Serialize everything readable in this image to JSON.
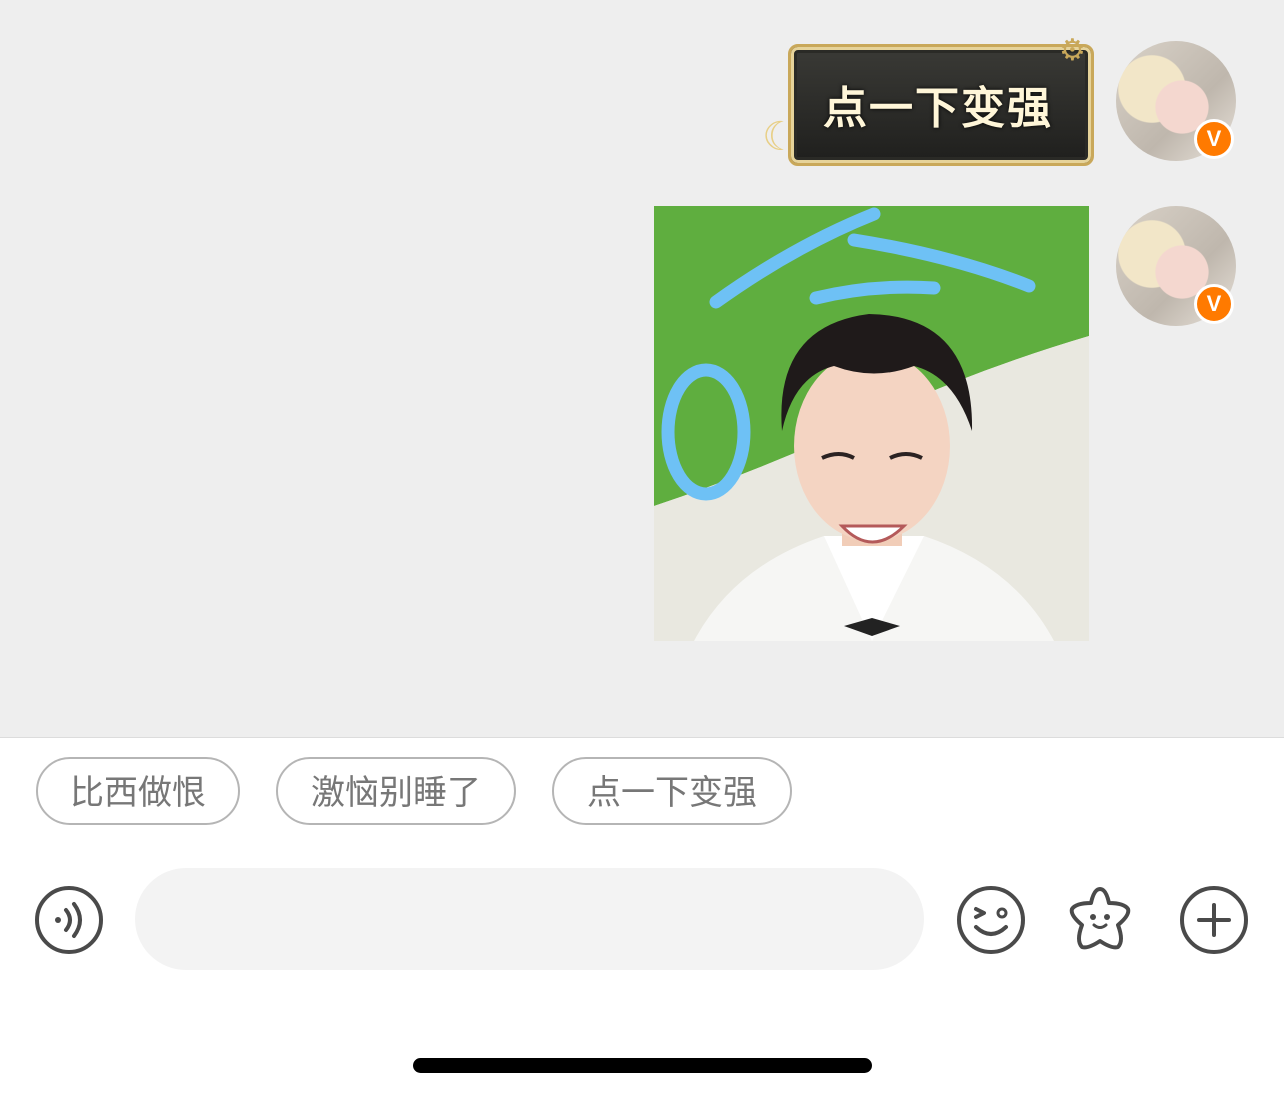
{
  "messages": [
    {
      "type": "sticker",
      "text": "点一下变强",
      "sender_badge": "V"
    },
    {
      "type": "image",
      "sender_badge": "V"
    }
  ],
  "quick_replies": [
    "比西做恨",
    "激恼别睡了",
    "点一下变强"
  ],
  "input": {
    "placeholder": "",
    "value": ""
  },
  "icons": {
    "voice": "voice-icon",
    "emoji": "emoji-icon",
    "sticker": "star-sticker-icon",
    "plus": "plus-icon"
  },
  "colors": {
    "chat_background": "#eeeeee",
    "badge": "#ff7a00",
    "chip_border": "#b5b5b5",
    "chip_text": "#777777"
  }
}
